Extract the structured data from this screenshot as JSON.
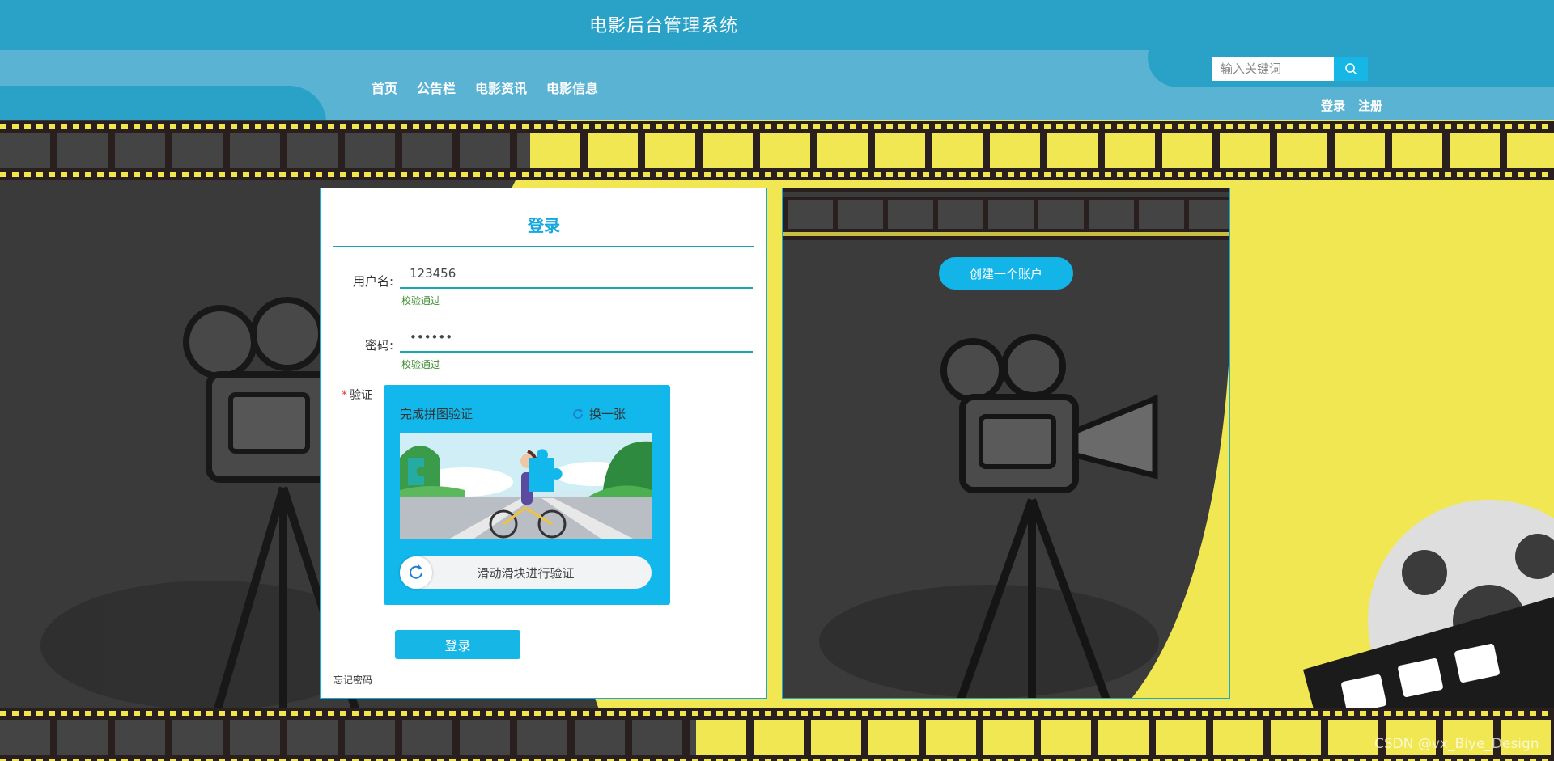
{
  "header": {
    "site_title": "电影后台管理系统",
    "nav": [
      "首页",
      "公告栏",
      "电影资讯",
      "电影信息"
    ],
    "search_placeholder": "输入关键词",
    "auth": {
      "login": "登录",
      "register": "注册"
    }
  },
  "login_form": {
    "title": "登录",
    "username_label": "用户名:",
    "username_value": "123456",
    "username_hint": "校验通过",
    "password_label": "密码:",
    "password_value": "••••••",
    "password_hint": "校验通过",
    "captcha_label": "验证",
    "captcha": {
      "title": "完成拼图验证",
      "refresh_label": "换一张",
      "slider_text": "滑动滑块进行验证"
    },
    "submit_label": "登录",
    "forgot_label": "忘记密码"
  },
  "right_panel": {
    "create_account_label": "创建一个账户"
  },
  "watermark": "CSDN @vx_Biye_Design",
  "colors": {
    "header_dark": "#2aa2c8",
    "header_light": "#5ab3d3",
    "accent": "#16b6e6",
    "scene_yellow": "#f0e752",
    "scene_dark": "#3a3a3a"
  }
}
